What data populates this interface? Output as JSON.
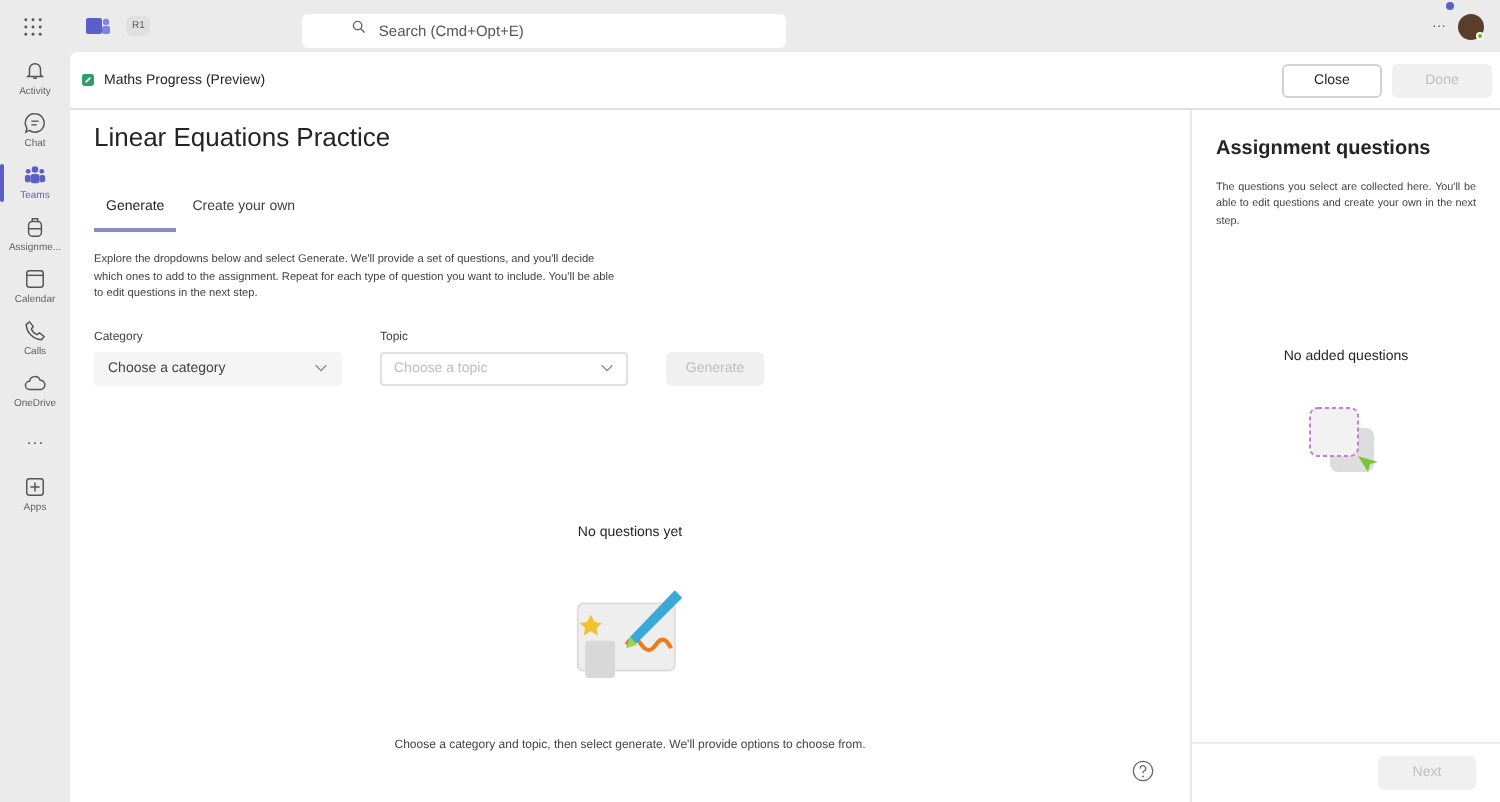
{
  "top_bar": {
    "badge": "R1",
    "search": {
      "placeholder": "Search (Cmd+Opt+E)"
    },
    "more": "···"
  },
  "rail": [
    {
      "label": "Activity",
      "kind": "bell",
      "selected": false
    },
    {
      "label": "Chat",
      "kind": "chat",
      "selected": false
    },
    {
      "label": "Teams",
      "kind": "teams",
      "selected": true
    },
    {
      "label": "Assignme...",
      "kind": "bag",
      "selected": false
    },
    {
      "label": "Calendar",
      "kind": "calendar",
      "selected": false
    },
    {
      "label": "Calls",
      "kind": "phone",
      "selected": false
    },
    {
      "label": "OneDrive",
      "kind": "cloud",
      "selected": false
    },
    {
      "label": "···",
      "kind": "more",
      "selected": false
    },
    {
      "label": "Apps",
      "kind": "plus",
      "selected": false
    }
  ],
  "header": {
    "app_title": "Maths Progress (Preview)",
    "buttons": [
      {
        "label": "Close",
        "disabled": false
      },
      {
        "label": "Done",
        "disabled": true
      }
    ]
  },
  "main": {
    "title": "Linear Equations Practice",
    "tabs": [
      {
        "label": "Generate",
        "selected": true
      },
      {
        "label": "Create your own",
        "selected": false
      }
    ],
    "intro": "Explore the dropdowns below and select Generate. We'll provide a set of questions, and you'll decide which ones to add to the assignment. Repeat for each type of question you want to include. You'll be able to edit questions in the next step.",
    "fields": [
      {
        "label": "Category",
        "placeholder": "Choose a category",
        "disabled": false
      },
      {
        "label": "Topic",
        "placeholder": "Choose a topic",
        "disabled": true
      }
    ],
    "generate": {
      "label": "Generate",
      "disabled": true
    },
    "empty_title": "No questions yet",
    "empty_hint": "Choose a category and topic, then select generate. We'll provide options to choose from."
  },
  "panel": {
    "title": "Assignment questions",
    "text": "The questions you select are collected here. You'll be able to edit questions and create your own in the next step.",
    "empty": "No added questions",
    "next": {
      "label": "Next",
      "disabled": true
    }
  }
}
